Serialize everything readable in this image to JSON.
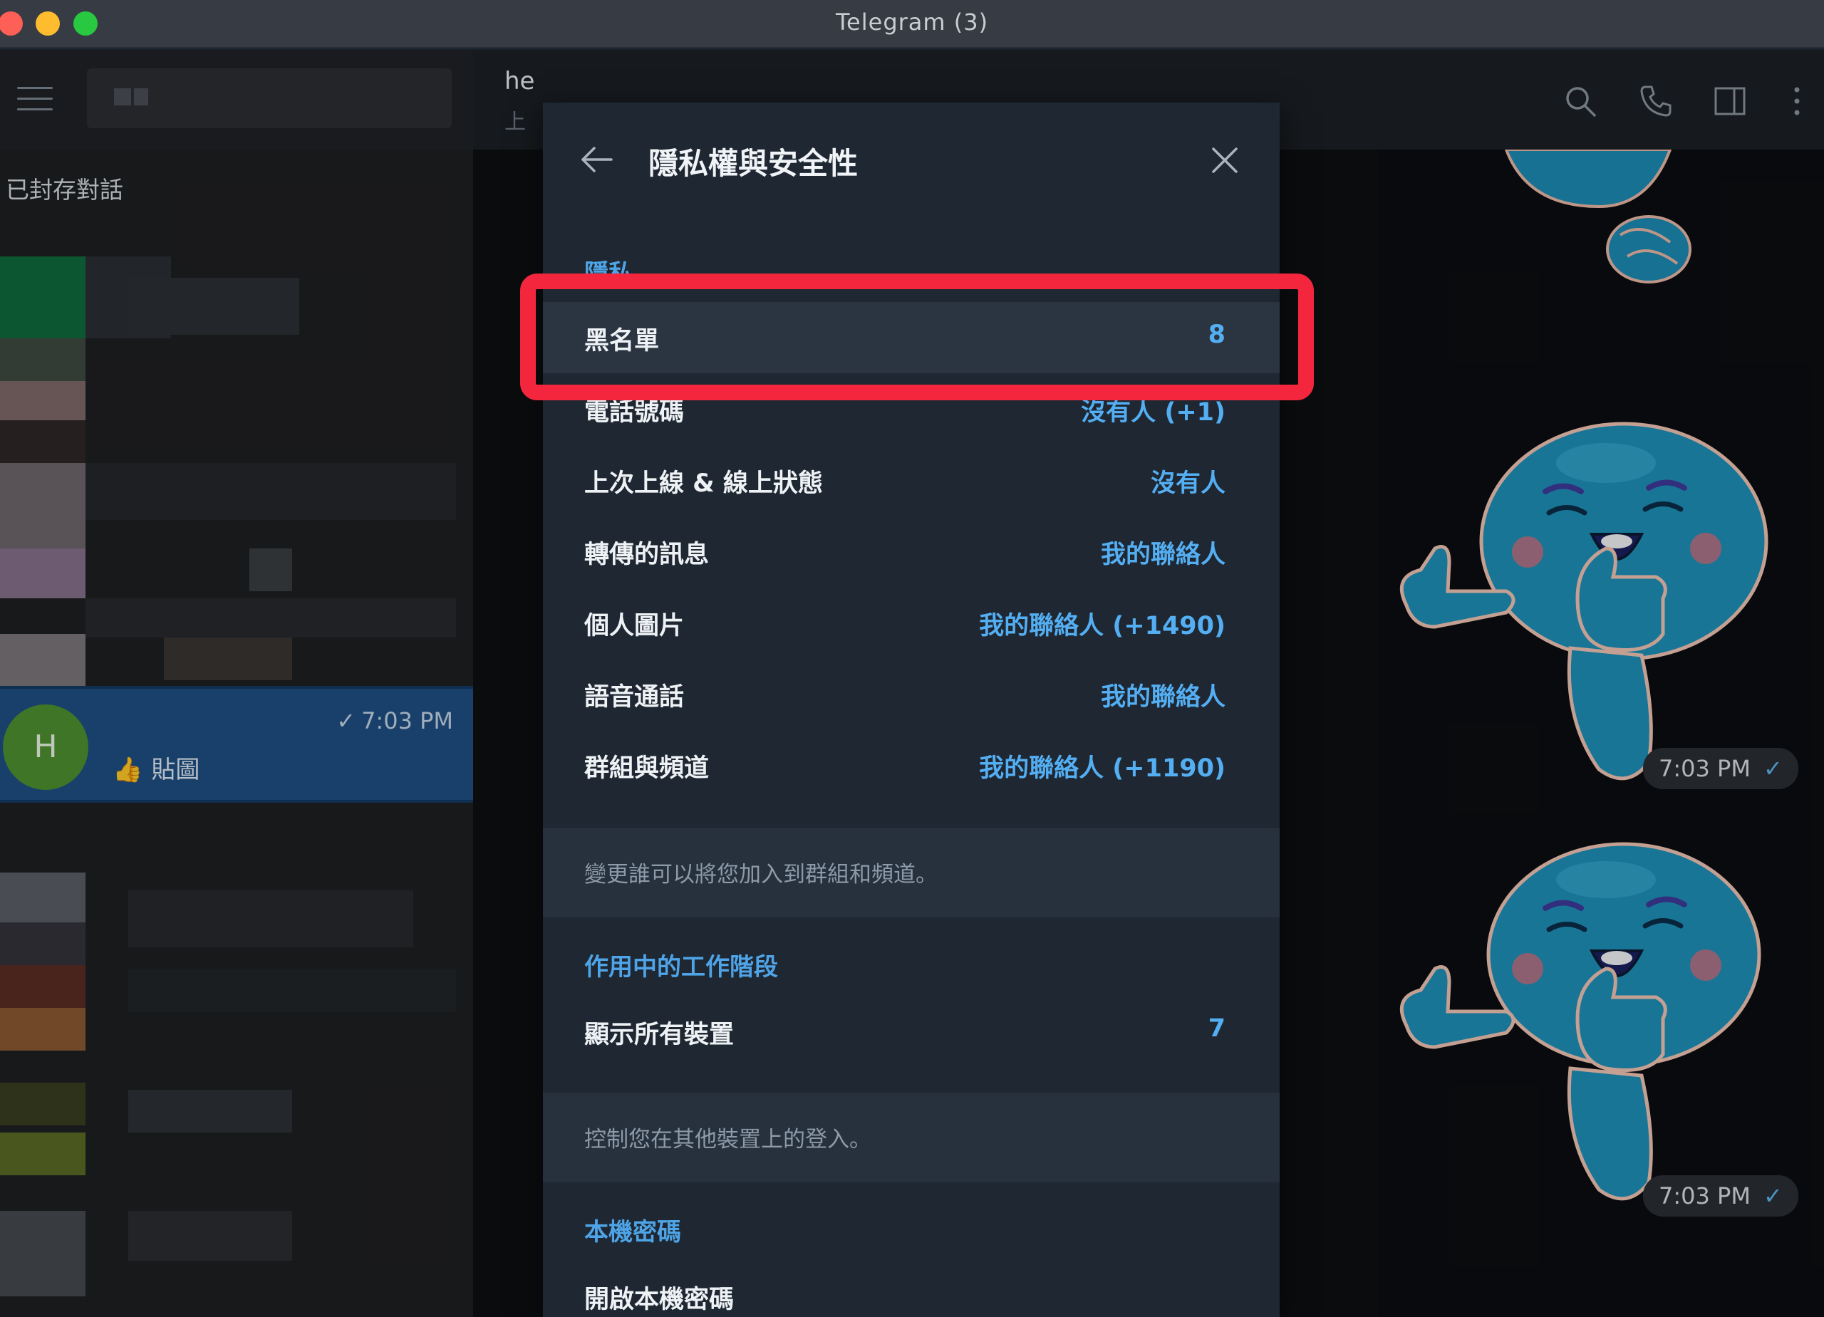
{
  "window": {
    "title": "Telegram (3)"
  },
  "sidebar": {
    "archived_label": "已封存對話",
    "selected_chat": {
      "avatar_letter": "H",
      "time": "7:03 PM",
      "check": "✓",
      "preview_emoji": "👍",
      "preview_text": "貼圖",
      "avatar_color": "#4c8f2f"
    }
  },
  "chat": {
    "peer_name": "he",
    "peer_status": "上",
    "messages": [
      {
        "time": "7:03 PM",
        "tick": "✓"
      },
      {
        "time": "7:03 PM",
        "tick": "✓"
      }
    ],
    "header_icons": [
      "search-icon",
      "phone-icon",
      "sidebar-toggle-icon",
      "more-icon"
    ]
  },
  "dialog": {
    "title": "隱私權與安全性",
    "privacy_section": "隱私",
    "privacy_rows": [
      {
        "label": "黑名單",
        "value": "8"
      },
      {
        "label": "電話號碼",
        "value": "沒有人 (+1)"
      },
      {
        "label": "上次上線 & 線上狀態",
        "value": "沒有人"
      },
      {
        "label": "轉傳的訊息",
        "value": "我的聯絡人"
      },
      {
        "label": "個人圖片",
        "value": "我的聯絡人 (+1490)"
      },
      {
        "label": "語音通話",
        "value": "我的聯絡人"
      },
      {
        "label": "群組與頻道",
        "value": "我的聯絡人 (+1190)"
      }
    ],
    "groups_note": "變更誰可以將您加入到群組和頻道。",
    "sessions_section": "作用中的工作階段",
    "sessions_row": {
      "label": "顯示所有裝置",
      "value": "7"
    },
    "sessions_note": "控制您在其他裝置上的登入。",
    "passcode_section": "本機密碼",
    "passcode_row": {
      "label": "開啟本機密碼"
    }
  },
  "colors": {
    "accent": "#4ea4e6",
    "highlight": "#f3263d",
    "dialog_bg": "#1e2732",
    "selected_chat_bg": "#1f4f83"
  }
}
